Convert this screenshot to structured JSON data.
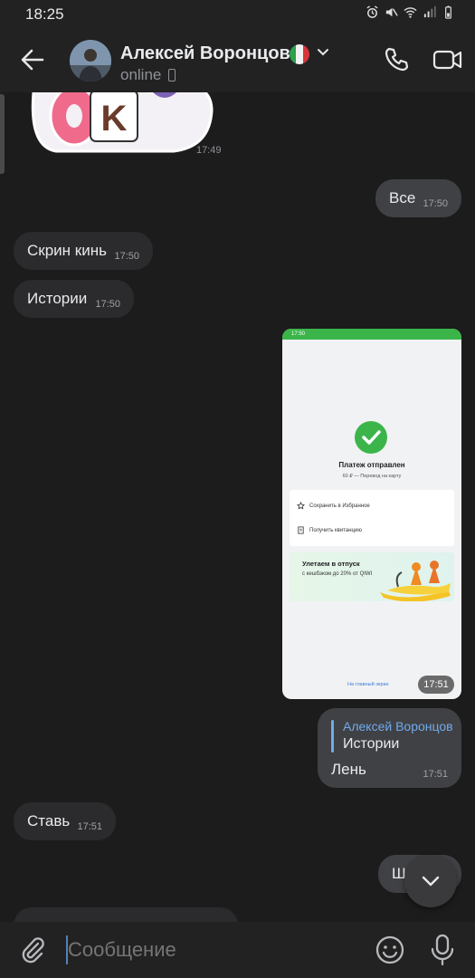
{
  "status_bar": {
    "time": "18:25"
  },
  "header": {
    "contact_name": "Алексей Воронцов",
    "presence": "online"
  },
  "messages": {
    "sticker_time": "17:49",
    "m1": {
      "text": "Все",
      "time": "17:50"
    },
    "m2": {
      "text": "Скрин кинь",
      "time": "17:50"
    },
    "m3": {
      "text": "Истории",
      "time": "17:50"
    },
    "photo": {
      "time": "17:51",
      "inner_status_time": "17:50",
      "title": "Платеж отправлен",
      "subtitle": "60 ₽ — Перевод на карту",
      "action_1": "Сохранить в Избранное",
      "action_2": "Получить квитанцию",
      "promo_title": "Улетаем в отпуск",
      "promo_text": "с кешбэком до 20% от QIWI",
      "link": "На главный экран"
    },
    "m5": {
      "reply_author": "Алексей Воронцов",
      "reply_text": "Истории",
      "text": "Лень",
      "time": "17:51"
    },
    "m6": {
      "text": "Ставь",
      "time": "17:51"
    },
    "m7": {
      "text": "Ш"
    }
  },
  "composer": {
    "placeholder": "Сообщение"
  },
  "colors": {
    "accent": "#71aaeb",
    "background": "#1c1c1d",
    "bubble_in": "#2b2b2d",
    "bubble_out": "#404144"
  }
}
